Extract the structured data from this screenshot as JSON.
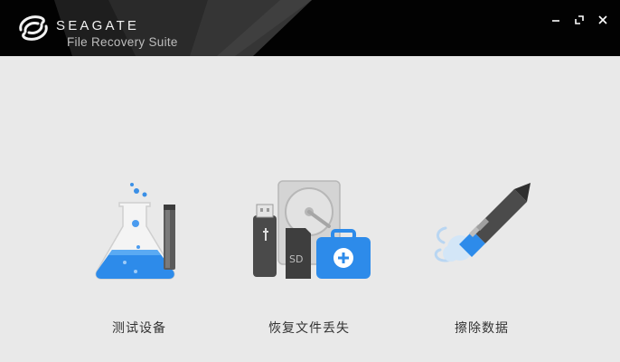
{
  "header": {
    "brand": "SEAGATE",
    "product": "File Recovery Suite",
    "logo_icon": "seagate-logo",
    "window_controls": [
      "minimize-icon",
      "restore-icon",
      "close-icon"
    ]
  },
  "tools": [
    {
      "label": "测试设备",
      "icon": "flask-test-icon"
    },
    {
      "label": "恢复文件丢失",
      "icon": "recover-files-icon"
    },
    {
      "label": "擦除数据",
      "icon": "erase-pencil-icon"
    }
  ],
  "colors": {
    "titlebar": "#020202",
    "background": "#e9e9e9",
    "accent_blue": "#2d8bea"
  }
}
